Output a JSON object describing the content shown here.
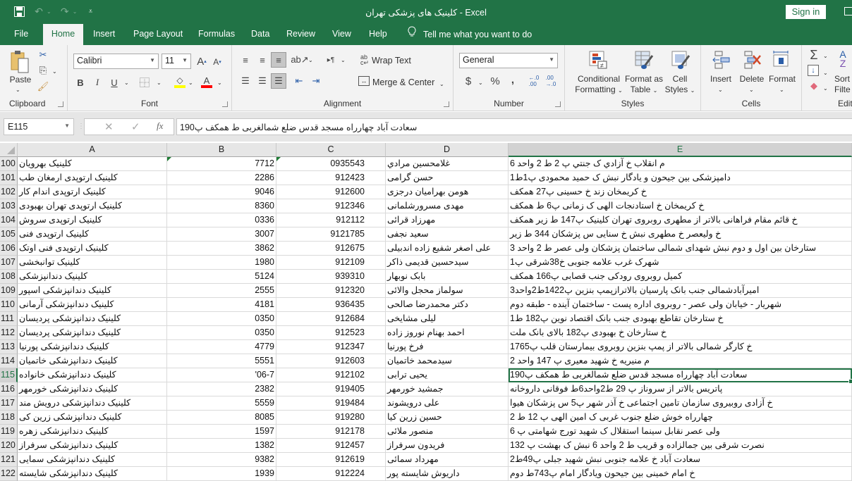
{
  "titlebar": {
    "title": "کلینیک های پزشکی تهران  -  Excel",
    "signin_label": "Sign in",
    "qat": {
      "save_icon": "save-icon",
      "undo_icon": "undo-icon",
      "redo_icon": "redo-icon",
      "customize_icon": "customize-qat-icon"
    }
  },
  "tabs": [
    {
      "label": "File"
    },
    {
      "label": "Home",
      "active": true
    },
    {
      "label": "Insert"
    },
    {
      "label": "Page Layout"
    },
    {
      "label": "Formulas"
    },
    {
      "label": "Data"
    },
    {
      "label": "Review"
    },
    {
      "label": "View"
    },
    {
      "label": "Help"
    }
  ],
  "tellme": {
    "label": "Tell me what you want to do",
    "icon": "lightbulb-icon"
  },
  "ribbon": {
    "clipboard": {
      "label": "Clipboard",
      "paste": "Paste"
    },
    "font": {
      "label": "Font",
      "name": "Calibri",
      "size": "11",
      "bold": "B",
      "italic": "I",
      "underline": "U",
      "fill_color": "#ffff00",
      "font_color": "#ff0000"
    },
    "alignment": {
      "label": "Alignment",
      "wrap": "Wrap Text",
      "merge": "Merge & Center"
    },
    "number": {
      "label": "Number",
      "format": "General",
      "currency": "$",
      "percent": "%",
      "comma": ","
    },
    "styles": {
      "label": "Styles",
      "conditional_1": "Conditional",
      "conditional_2": "Formatting",
      "table_1": "Format as",
      "table_2": "Table",
      "cell_1": "Cell",
      "cell_2": "Styles"
    },
    "cells": {
      "label": "Cells",
      "insert": "Insert",
      "delete": "Delete",
      "format": "Format"
    },
    "editing": {
      "label": "Editi",
      "sort_1": "Sort",
      "sort_2": "Filte"
    }
  },
  "formula_bar": {
    "name_box": "E115",
    "fx": "fx",
    "value": "سعادت آباد چهارراه مسجد قدس ضلع شمالغربی ط همکف پ190"
  },
  "columns": [
    "A",
    "B",
    "C",
    "D",
    "E"
  ],
  "selected_cell": {
    "column": "E",
    "row": 115
  },
  "rows": [
    {
      "n": "100",
      "a": "کلینیک   بهرویان",
      "b": "7712",
      "c": "0935543",
      "d": "غلامحسين مرادي",
      "e": "م انقلاب خ آزادي ک جنتي پ 2 ط 2 واحد 6"
    },
    {
      "n": "101",
      "a": "کلینیک ارتوپدی ارمغان طب",
      "b": "2286",
      "c": "912423",
      "d": "حسن گرامی",
      "e": "دامپزشکی بین جیحون و یادگار نبش ک حمید محمودی پ1ط1"
    },
    {
      "n": "102",
      "a": "کلینیک ارتوپدی اندام کار",
      "b": "9046",
      "c": "912600",
      "d": "هومن بهرامیان درجزی",
      "e": "خ کریمخان زند خ حسینی پ27 همکف"
    },
    {
      "n": "103",
      "a": "کلینیک ارتوپدی تهران بهبودی",
      "b": "8360",
      "c": "912346",
      "d": "مهدی مسرورشلمانی",
      "e": "خ کریمخان خ استادنجات الهی ک زمانی پ6 ط همکف"
    },
    {
      "n": "104",
      "a": "کلینیک ارتوپدی سروش",
      "b": "0336",
      "c": "912112",
      "d": "مهرزاد قرائی",
      "e": "خ قائم مقام فراهانی بالاتر از مطهری روبروی تهران کلینیک پ147 ط زیر  همکف"
    },
    {
      "n": "105",
      "a": "کلینیک ارتوپدی فنی",
      "b": "3007",
      "c": "9121785",
      "d": "سعید نجفی",
      "e": "خ ولیعصر خ مطهری نبش خ سنایی س پزشکان 344 ط زیر"
    },
    {
      "n": "106",
      "a": "کلینیک ارتوپدی فنی اوتک",
      "b": "3862",
      "c": "912675",
      "d": "علی اصغر شفیع زاده اندبیلی",
      "e": "ستارخان بین اول و دوم نبش شهدای شمالی ساختمان پزشکان ولی عصر ط 2 واحد 3"
    },
    {
      "n": "107",
      "a": "کلینیک توانبخشی",
      "b": "1980",
      "c": "912109",
      "d": "سیدحسین قدیمی ذاکر",
      "e": "شهرک غرب علامه جنوبی خ38شرقی پ1"
    },
    {
      "n": "108",
      "a": "کلینیک دندانپزشکی",
      "b": "5124",
      "c": "939310",
      "d": "بابک نوبهار",
      "e": "کمیل روبروی رودکی جنب قصابی پ166 همکف"
    },
    {
      "n": "109",
      "a": "کلینیک دندانپزشکی اسپور",
      "b": "2555",
      "c": "912320",
      "d": "سولماز محجل والائی",
      "e": "امیرآبادشمالی جنب بانک پارسیان بالاترازپمپ بنزین پ1422ط2واحد3"
    },
    {
      "n": "110",
      "a": "کلینیک دندانپزشکی آرمانی",
      "b": "4181",
      "c": "936435",
      "d": "دکتر محمدرضا صالحی",
      "e": "شهریار - خیابان ولی عصر - روبروی اداره پست - ساختمان آینده - طبقه دوم"
    },
    {
      "n": "111",
      "a": "کلینیک دندانپزشکی پردیسان",
      "b": "0350",
      "c": "912684",
      "d": "لیلی مشایخی",
      "e": "خ ستارخان تقاطع بهبودی جنب بانک اقتصاد نوین پ182 ط1"
    },
    {
      "n": "112",
      "a": "کلینیک دندانپزشکی پردیسان",
      "b": "0350",
      "c": "912523",
      "d": "احمد بهنام نوروز زاده",
      "e": "خ ستارخان خ بهبودی پ182 بالای بانک ملت"
    },
    {
      "n": "113",
      "a": "کلینیک دندانپزشکی پورنیا",
      "b": "4779",
      "c": "912347",
      "d": "فرخ پورنیا",
      "e": "خ کارگر شمالی بالاتر از پمپ بنزین روبروی بیمارستان قلب پ1765"
    },
    {
      "n": "114",
      "a": "کلینیک دندانپزشکی خاتمیان",
      "b": "5551",
      "c": "912603",
      "d": "سیدمحمد خاتمیان",
      "e": "م منیریه خ شهید معیری پ 147 واحد 2"
    },
    {
      "n": "115",
      "a": "کلینیک دندانپزشکی خانواده",
      "b": "'06-7",
      "c": "912102",
      "d": "یحیی ترابی",
      "e": "سعادت آباد چهارراه مسجد قدس ضلع شمالغربی ط همکف پ190"
    },
    {
      "n": "116",
      "a": "کلینیک دندانپزشکی خورمهر",
      "b": "2382",
      "c": "919405",
      "d": "جمشید خورمهر",
      "e": "پاتریس بالاتر از سروناز پ 29 ط2واحد6ط فوقانی داروخانه"
    },
    {
      "n": "117",
      "a": "کلینیک دندانپزشکی درویش مند",
      "b": "5559",
      "c": "919484",
      "d": "علی درویشوند",
      "e": "خ آزادی روبیروی سازمان تامین اجتماعی خ آذر شهر پ5 س پزشکان هیوا"
    },
    {
      "n": "118",
      "a": "کلینیک دندانپزشکی زرین کی",
      "b": "8085",
      "c": "919280",
      "d": "حسین زرین کیا",
      "e": "چهارراه خوش ضلع جنوب غربی ک امین الهی پ 12 ط 2"
    },
    {
      "n": "119",
      "a": "کلینیک دندانپزشکی زهره",
      "b": "1597",
      "c": "912178",
      "d": "منصور ملائی",
      "e": "ولی عصر نقابل سینما استقلال ک شهید تورج شهامتی پ 6"
    },
    {
      "n": "120",
      "a": "کلینیک دندانپزشکی سرفراز",
      "b": "1382",
      "c": "912457",
      "d": "فریدون سرفراز",
      "e": "نصرت شرقی بین جمالزاده و قریب ط 2 واحد 6 نبش ک بهشت پ 132"
    },
    {
      "n": "121",
      "a": "کلینیک دندانپزشکی سمایی",
      "b": "9382",
      "c": "912619",
      "d": "مهرداد سمائی",
      "e": "سعادت آباد خ علامه جنوبی نبش شهید جبلی پ49ط2"
    },
    {
      "n": "122",
      "a": "کلینیک دندانپزشکی شایسته",
      "b": "1939",
      "c": "912224",
      "d": "داریوش شایسته پور",
      "e": "خ امام خمینی بین جیحون ویادگار امام پ743ط دوم"
    }
  ]
}
